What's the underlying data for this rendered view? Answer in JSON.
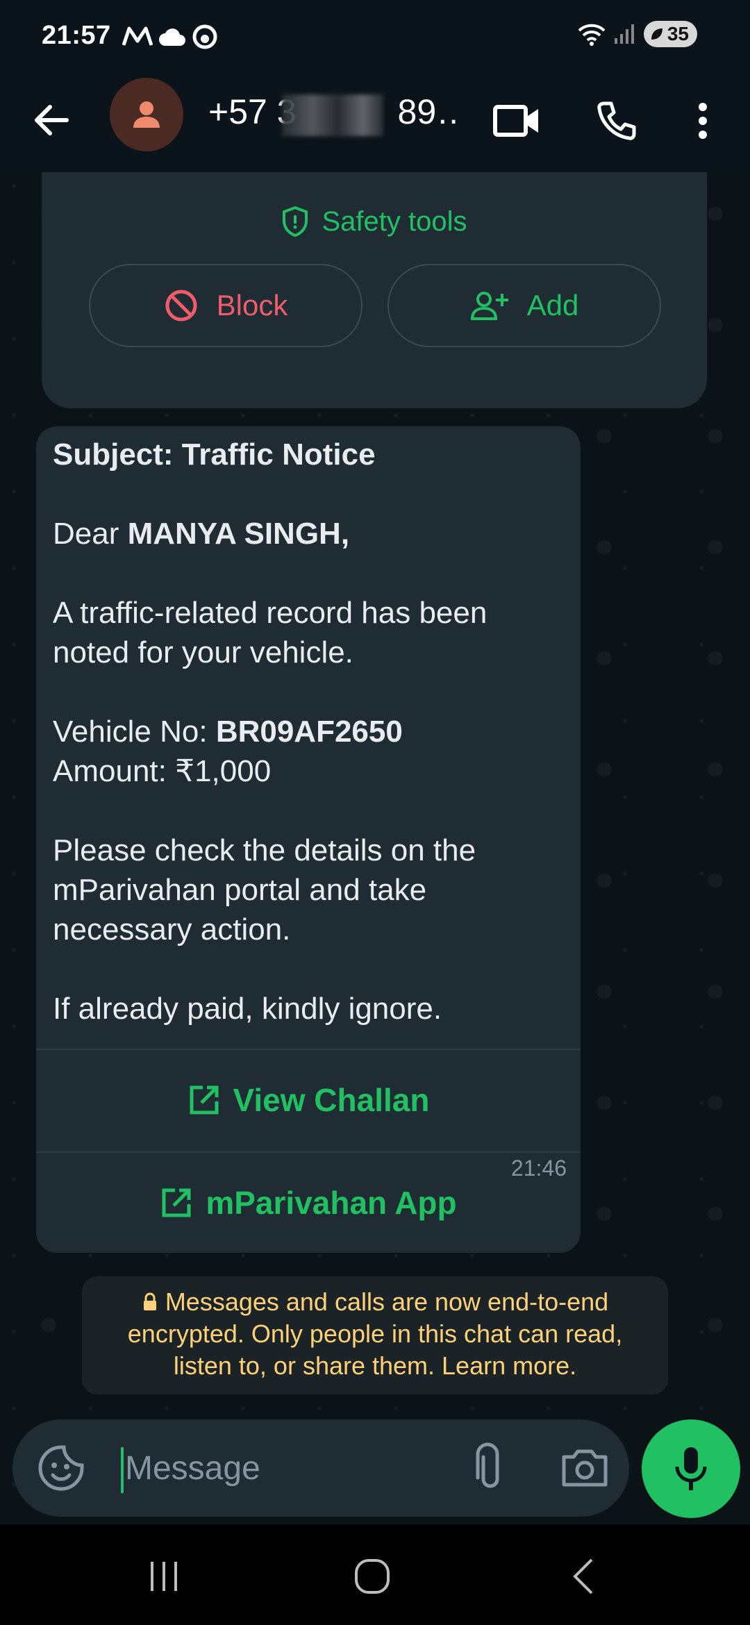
{
  "status_bar": {
    "time": "21:57",
    "battery": "35",
    "icons": [
      "m-icon",
      "cloud-icon",
      "sync-icon",
      "wifi-icon",
      "signal-icon",
      "battery-icon"
    ]
  },
  "header": {
    "contact": "+57 3",
    "contact_tail": "89…",
    "icons": [
      "back-arrow-icon",
      "person-icon",
      "video-call-icon",
      "phone-icon",
      "more-vert-icon"
    ]
  },
  "safety_card": {
    "safety_tools_label": "Safety tools",
    "block_label": "Block",
    "add_label": "Add"
  },
  "message": {
    "subject": "Subject: Traffic Notice",
    "greeting_prefix": "Dear ",
    "greeting_name": "MANYA SINGH,",
    "line1": "A traffic-related record has been noted for your vehicle.",
    "vehicle_label": "Vehicle No: ",
    "vehicle_no": "BR09AF2650",
    "amount_label": "Amount: ",
    "amount": "₹1,000",
    "line3": "Please check the details on the mParivahan portal and take necessary action.",
    "line4": "If already paid, kindly ignore.",
    "time": "21:46",
    "action1": "View Challan",
    "action2": "mParivahan App"
  },
  "encryption_notice": {
    "text": "Messages and calls are now end-to-end encrypted. Only people in this chat can read, listen to, or share them. Learn more."
  },
  "composer": {
    "placeholder": "Message"
  },
  "colors": {
    "accent": "#21c063",
    "danger": "#f15c6d",
    "notice": "#ffd279",
    "bubble": "#1f2c33"
  }
}
